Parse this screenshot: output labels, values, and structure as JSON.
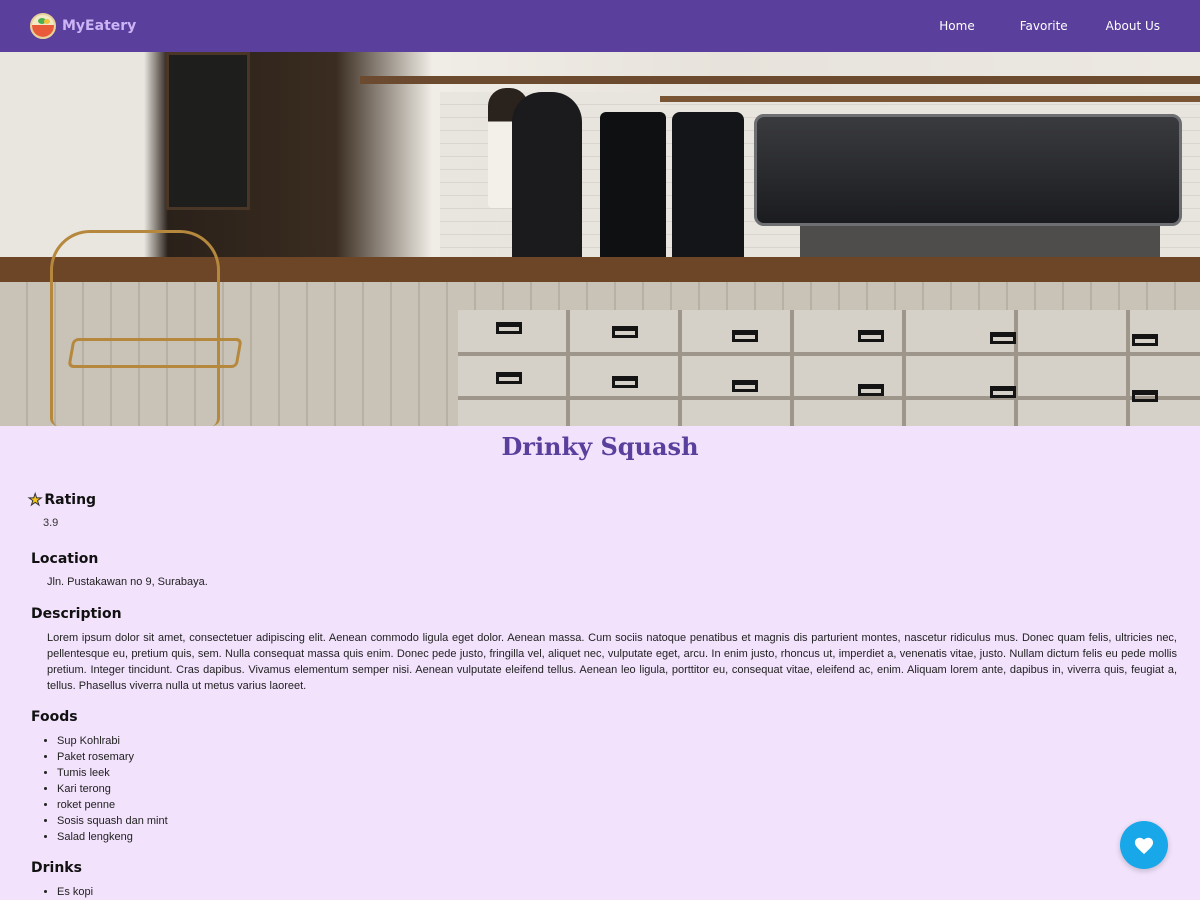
{
  "brand": {
    "name": "MyEatery"
  },
  "nav": {
    "home": "Home",
    "favorite": "Favorite",
    "about": "About Us"
  },
  "restaurant": {
    "name": "Drinky Squash",
    "rating_label": "Rating",
    "rating": "3.9",
    "location_label": "Location",
    "location": "Jln. Pustakawan no 9, Surabaya.",
    "description_label": "Description",
    "description": "Lorem ipsum dolor sit amet, consectetuer adipiscing elit. Aenean commodo ligula eget dolor. Aenean massa. Cum sociis natoque penatibus et magnis dis parturient montes, nascetur ridiculus mus. Donec quam felis, ultricies nec, pellentesque eu, pretium quis, sem. Nulla consequat massa quis enim. Donec pede justo, fringilla vel, aliquet nec, vulputate eget, arcu. In enim justo, rhoncus ut, imperdiet a, venenatis vitae, justo. Nullam dictum felis eu pede mollis pretium. Integer tincidunt. Cras dapibus. Vivamus elementum semper nisi. Aenean vulputate eleifend tellus. Aenean leo ligula, porttitor eu, consequat vitae, eleifend ac, enim. Aliquam lorem ante, dapibus in, viverra quis, feugiat a, tellus. Phasellus viverra nulla ut metus varius laoreet.",
    "foods_label": "Foods",
    "foods": [
      "Sup Kohlrabi",
      "Paket rosemary",
      "Tumis leek",
      "Kari terong",
      "roket penne",
      "Sosis squash dan mint",
      "Salad lengkeng"
    ],
    "drinks_label": "Drinks",
    "drinks": [
      "Es kopi"
    ]
  },
  "icons": {
    "logo": "bowl-logo-icon",
    "star": "star-icon",
    "heart": "heart-icon"
  },
  "colors": {
    "navbar": "#5a3f9c",
    "background": "#f2e2fc",
    "title": "#5a3f9c",
    "favorite_button": "#18a7e8",
    "brand_text": "#cdb4f5"
  }
}
